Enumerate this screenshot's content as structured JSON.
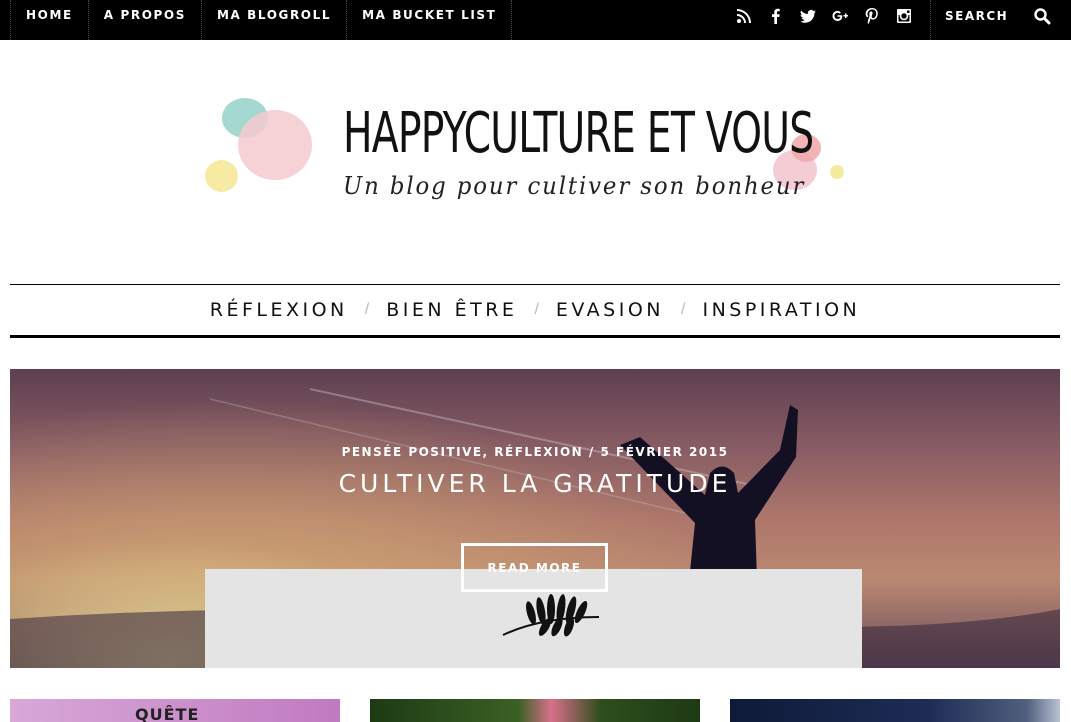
{
  "top_nav": {
    "items": [
      "HOME",
      "A PROPOS",
      "MA BLOGROLL",
      "MA BUCKET LIST"
    ]
  },
  "social_icons": [
    "rss-icon",
    "facebook-icon",
    "twitter-icon",
    "google-plus-icon",
    "pinterest-icon",
    "instagram-icon"
  ],
  "search": {
    "placeholder": "SEARCH"
  },
  "logo": {
    "title": "HAPPYCULTURE ET VOUS",
    "tagline": "Un blog pour cultiver son bonheur"
  },
  "category_nav": {
    "items": [
      "RÉFLEXION",
      "BIEN ÊTRE",
      "EVASION",
      "INSPIRATION"
    ],
    "separator": "/"
  },
  "hero": {
    "categories": "PENSÉE POSITIVE, RÉFLEXION",
    "date": "5 FÉVRIER 2015",
    "meta_separator": "/",
    "title": "CULTIVER LA GRATITUDE",
    "button_label": "READ MORE"
  },
  "thumbnails": [
    {
      "visible_text": "QUÊTE"
    },
    {
      "visible_text": ""
    },
    {
      "visible_text": ""
    }
  ]
}
